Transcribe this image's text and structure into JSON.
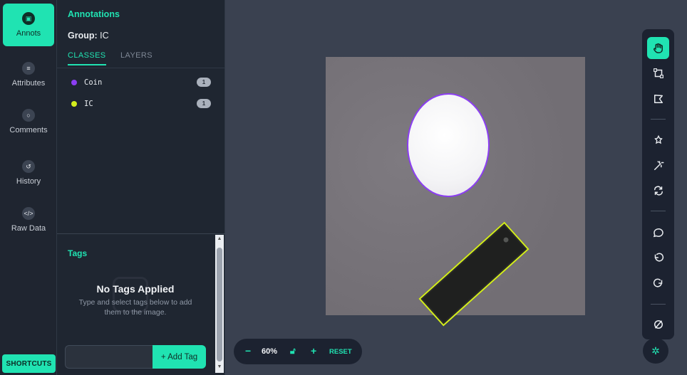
{
  "rail": {
    "items": [
      {
        "label": "Annots",
        "icon": "annotations-icon",
        "active": true
      },
      {
        "label": "Attributes",
        "icon": "list-icon",
        "active": false
      },
      {
        "label": "Comments",
        "icon": "comment-icon",
        "active": false
      },
      {
        "label": "History",
        "icon": "history-icon",
        "active": false
      },
      {
        "label": "Raw Data",
        "icon": "code-icon",
        "active": false
      }
    ],
    "shortcuts_label": "SHORTCUTS"
  },
  "panel": {
    "title": "Annotations",
    "group_label": "Group:",
    "group_value": "IC",
    "tabs": [
      "CLASSES",
      "LAYERS"
    ],
    "classes": [
      {
        "name": "Coin",
        "count": "1",
        "color": "#8c3ef2"
      },
      {
        "name": "IC",
        "count": "1",
        "color": "#d4ee1d"
      }
    ]
  },
  "tags": {
    "title": "Tags",
    "empty_title": "No Tags Applied",
    "empty_subtitle": "Type and select tags below to add them to the image.",
    "input_value": "",
    "add_button": "+ Add Tag"
  },
  "zoom": {
    "value": "60%",
    "reset_label": "RESET"
  },
  "toolbar": {
    "tools": [
      "pan-icon",
      "bbox-icon",
      "polygon-icon",
      "smart-select-icon",
      "magic-wand-icon",
      "swap-icon",
      "comment-icon",
      "undo-icon",
      "redo-icon",
      "hide-icon"
    ],
    "active_tool": "pan-icon"
  },
  "colors": {
    "accent": "#20e3b2",
    "coin_class": "#8c3ef2",
    "ic_class": "#d4ee1d"
  }
}
